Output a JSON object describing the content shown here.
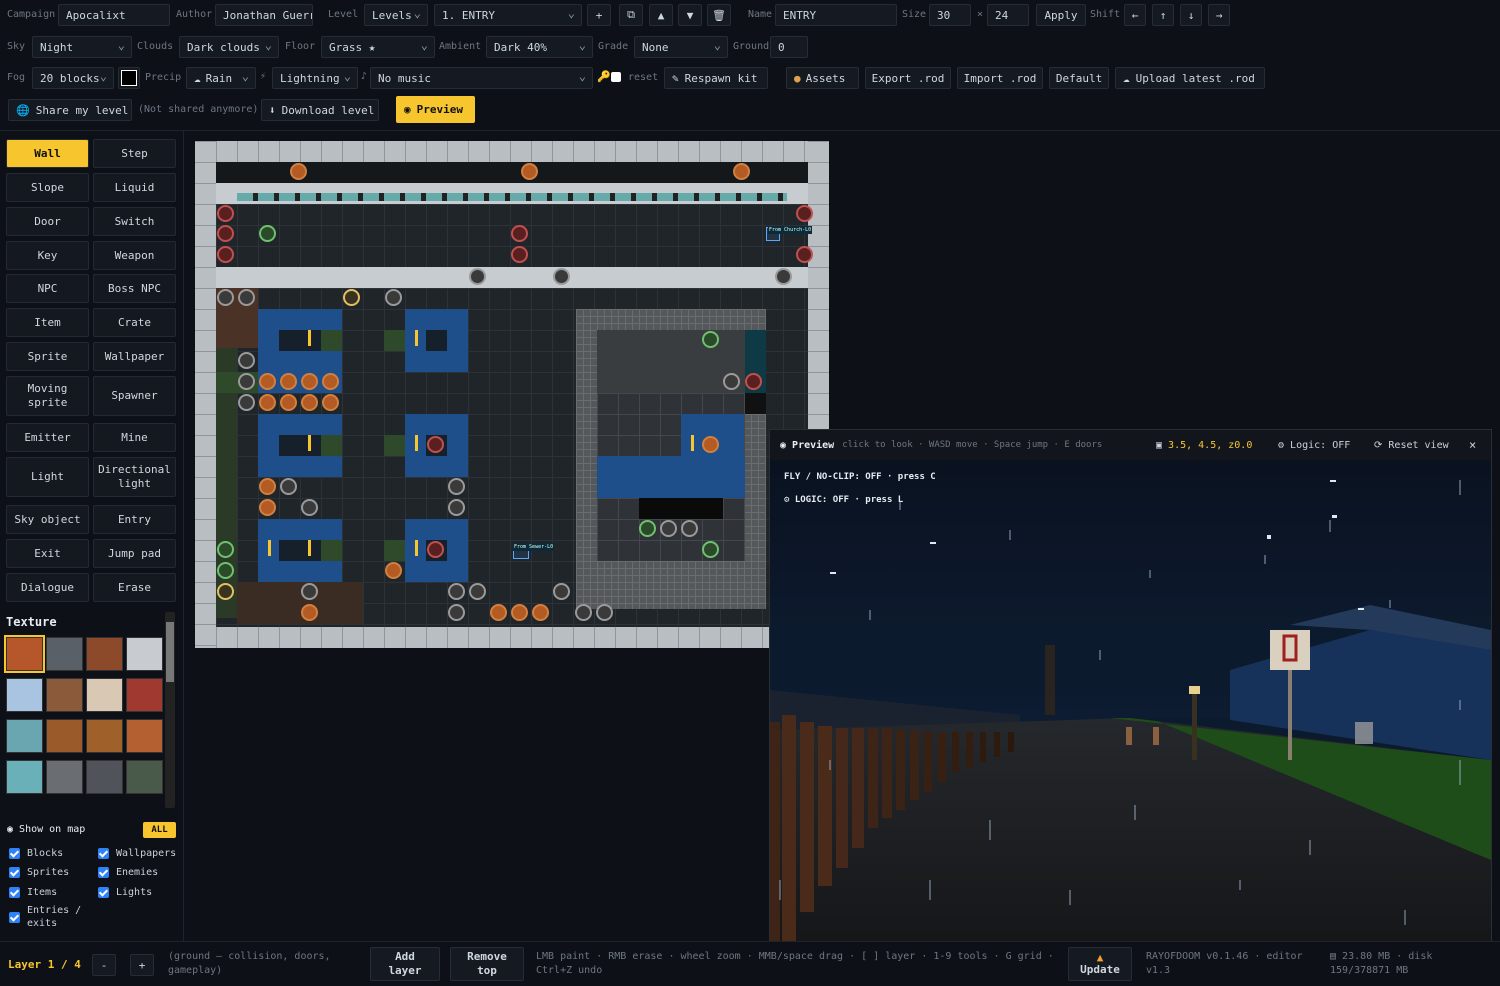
{
  "toolbar": {
    "campaign_label": "Campaign",
    "campaign_value": "Apocalixt",
    "author_label": "Author",
    "author_value": "Jonathan Guerr",
    "level_label": "Level",
    "levels_select": "Levels",
    "level_select": "1. ENTRY",
    "name_label": "Name",
    "name_value": "ENTRY",
    "size_label": "Size",
    "size_w": "30",
    "size_x": "×",
    "size_h": "24",
    "apply": "Apply",
    "shift_label": "Shift",
    "sky_label": "Sky",
    "sky_value": "Night",
    "clouds_label": "Clouds",
    "clouds_value": "Dark clouds",
    "floor_label": "Floor",
    "floor_value": "Grass ★",
    "ambient_label": "Ambient",
    "ambient_value": "Dark 40%",
    "grade_label": "Grade",
    "grade_value": "None",
    "ground_label": "Ground",
    "ground_value": "0",
    "fog_label": "Fog",
    "fog_value": "20 blocks",
    "precip_label": "Precip",
    "precip_value": "Rain",
    "lightning_value": "Lightning",
    "music_value": "No music",
    "reset": "reset",
    "respawn": "Respawn kit",
    "assets": "Assets",
    "export": "Export .rod",
    "import": "Import .rod",
    "default": "Default",
    "upload": "Upload latest .rod",
    "share": "Share my level",
    "not_shared": "(Not shared anymore)",
    "download": "Download level",
    "preview": "Preview"
  },
  "tools": [
    "Wall",
    "Step",
    "Slope",
    "Liquid",
    "Door",
    "Switch",
    "Key",
    "Weapon",
    "NPC",
    "Boss NPC",
    "Item",
    "Crate",
    "Sprite",
    "Wallpaper",
    "Moving sprite",
    "Spawner",
    "Emitter",
    "Mine",
    "Light",
    "Directional light",
    "Sky object",
    "Entry",
    "Exit",
    "Jump pad",
    "Dialogue",
    "Erase"
  ],
  "texture_title": "Texture",
  "show_on_map": {
    "title": "Show on map",
    "all": "ALL",
    "items": [
      "Blocks",
      "Wallpapers",
      "Sprites",
      "Enemies",
      "Items",
      "Lights",
      "Entries / exits"
    ]
  },
  "map_labels": {
    "church": "From Church-L0",
    "sewer": "From Sewer-L0"
  },
  "preview": {
    "title": "Preview",
    "hint": "click to look · WASD move · Space jump · E doors",
    "coords": "3.5, 4.5, z0.0",
    "logic": "Logic: OFF",
    "reset_view": "Reset view",
    "close": "×",
    "hud1": "FLY / NO-CLIP: OFF · press C",
    "hud2": "LOGIC: OFF · press L"
  },
  "bottom": {
    "layer_label": "Layer",
    "layer_current": "1",
    "layer_sep": "/",
    "layer_total": "4",
    "minus": "-",
    "plus": "+",
    "layer_desc": "(ground — collision, doors, gameplay)",
    "add_layer": "Add layer",
    "remove_top": "Remove top",
    "help1": "LMB paint · RMB erase · wheel zoom · MMB/space drag · [ ] layer · 1-9 tools · G grid ·",
    "help2": "Ctrl+Z undo",
    "update": "Update",
    "version1": "RAYOFDOOM v0.1.46 · editor",
    "version2": "v1.3",
    "disk1": "23.80 MB · disk",
    "disk2": "159/378871 MB"
  }
}
